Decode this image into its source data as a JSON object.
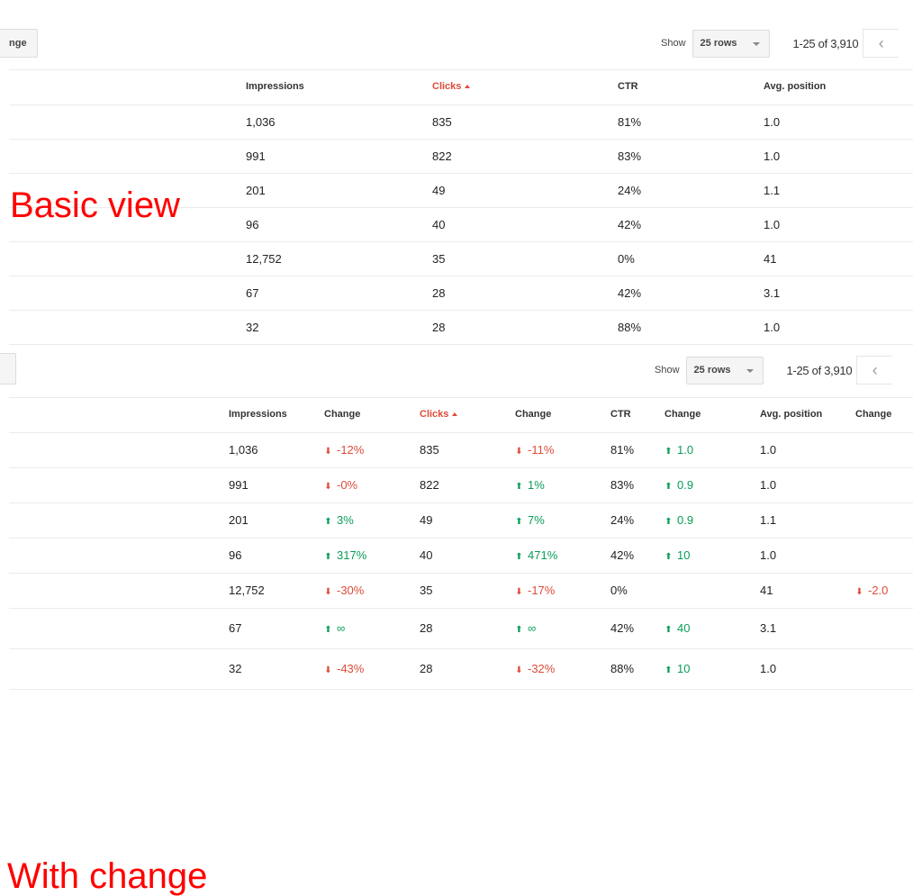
{
  "colors": {
    "sorted_header": "#dd4b39",
    "positive": "#0a9d58",
    "negative": "#dd4b39",
    "annotation": "#ff0000"
  },
  "annotations": {
    "basic": "Basic view",
    "change": "With change"
  },
  "basic": {
    "left_button": "nge",
    "pager": {
      "show_label": "Show",
      "rows_select": "25 rows",
      "range": "1-25 of 3,910",
      "prev_icon": "‹"
    },
    "headers": {
      "impressions": "Impressions",
      "clicks": "Clicks",
      "ctr": "CTR",
      "position": "Avg. position"
    },
    "rows": [
      {
        "impressions": "1,036",
        "clicks": "835",
        "ctr": "81%",
        "position": "1.0"
      },
      {
        "impressions": "991",
        "clicks": "822",
        "ctr": "83%",
        "position": "1.0"
      },
      {
        "impressions": "201",
        "clicks": "49",
        "ctr": "24%",
        "position": "1.1"
      },
      {
        "impressions": "96",
        "clicks": "40",
        "ctr": "42%",
        "position": "1.0"
      },
      {
        "impressions": "12,752",
        "clicks": "35",
        "ctr": "0%",
        "position": "41"
      },
      {
        "impressions": "67",
        "clicks": "28",
        "ctr": "42%",
        "position": "3.1"
      },
      {
        "impressions": "32",
        "clicks": "28",
        "ctr": "88%",
        "position": "1.0"
      }
    ]
  },
  "change": {
    "left_button": "",
    "pager": {
      "show_label": "Show",
      "rows_select": "25 rows",
      "range": "1-25 of 3,910",
      "prev_icon": "‹"
    },
    "headers": {
      "impressions": "Impressions",
      "impressions_change": "Change",
      "clicks": "Clicks",
      "clicks_change": "Change",
      "ctr": "CTR",
      "ctr_change": "Change",
      "position": "Avg. position",
      "position_change": "Change"
    },
    "rows": [
      {
        "impressions": "1,036",
        "impressions_change": {
          "dir": "down",
          "text": "-12%"
        },
        "clicks": "835",
        "clicks_change": {
          "dir": "down",
          "text": "-11%"
        },
        "ctr": "81%",
        "ctr_change": {
          "dir": "up",
          "text": "1.0"
        },
        "position": "1.0",
        "position_change": null
      },
      {
        "impressions": "991",
        "impressions_change": {
          "dir": "down",
          "text": "-0%"
        },
        "clicks": "822",
        "clicks_change": {
          "dir": "up",
          "text": "1%"
        },
        "ctr": "83%",
        "ctr_change": {
          "dir": "up",
          "text": "0.9"
        },
        "position": "1.0",
        "position_change": null
      },
      {
        "impressions": "201",
        "impressions_change": {
          "dir": "up",
          "text": "3%"
        },
        "clicks": "49",
        "clicks_change": {
          "dir": "up",
          "text": "7%"
        },
        "ctr": "24%",
        "ctr_change": {
          "dir": "up",
          "text": "0.9"
        },
        "position": "1.1",
        "position_change": null
      },
      {
        "impressions": "96",
        "impressions_change": {
          "dir": "up",
          "text": "317%"
        },
        "clicks": "40",
        "clicks_change": {
          "dir": "up",
          "text": "471%"
        },
        "ctr": "42%",
        "ctr_change": {
          "dir": "up",
          "text": "10"
        },
        "position": "1.0",
        "position_change": null
      },
      {
        "impressions": "12,752",
        "impressions_change": {
          "dir": "down",
          "text": "-30%"
        },
        "clicks": "35",
        "clicks_change": {
          "dir": "down",
          "text": "-17%"
        },
        "ctr": "0%",
        "ctr_change": null,
        "position": "41",
        "position_change": {
          "dir": "down",
          "text": "-2.0"
        }
      },
      {
        "impressions": "67",
        "impressions_change": {
          "dir": "up",
          "text": "∞"
        },
        "clicks": "28",
        "clicks_change": {
          "dir": "up",
          "text": "∞"
        },
        "ctr": "42%",
        "ctr_change": {
          "dir": "up",
          "text": "40"
        },
        "position": "3.1",
        "position_change": null
      },
      {
        "impressions": "32",
        "impressions_change": {
          "dir": "down",
          "text": "-43%"
        },
        "clicks": "28",
        "clicks_change": {
          "dir": "down",
          "text": "-32%"
        },
        "ctr": "88%",
        "ctr_change": {
          "dir": "up",
          "text": "10"
        },
        "position": "1.0",
        "position_change": null
      }
    ]
  }
}
